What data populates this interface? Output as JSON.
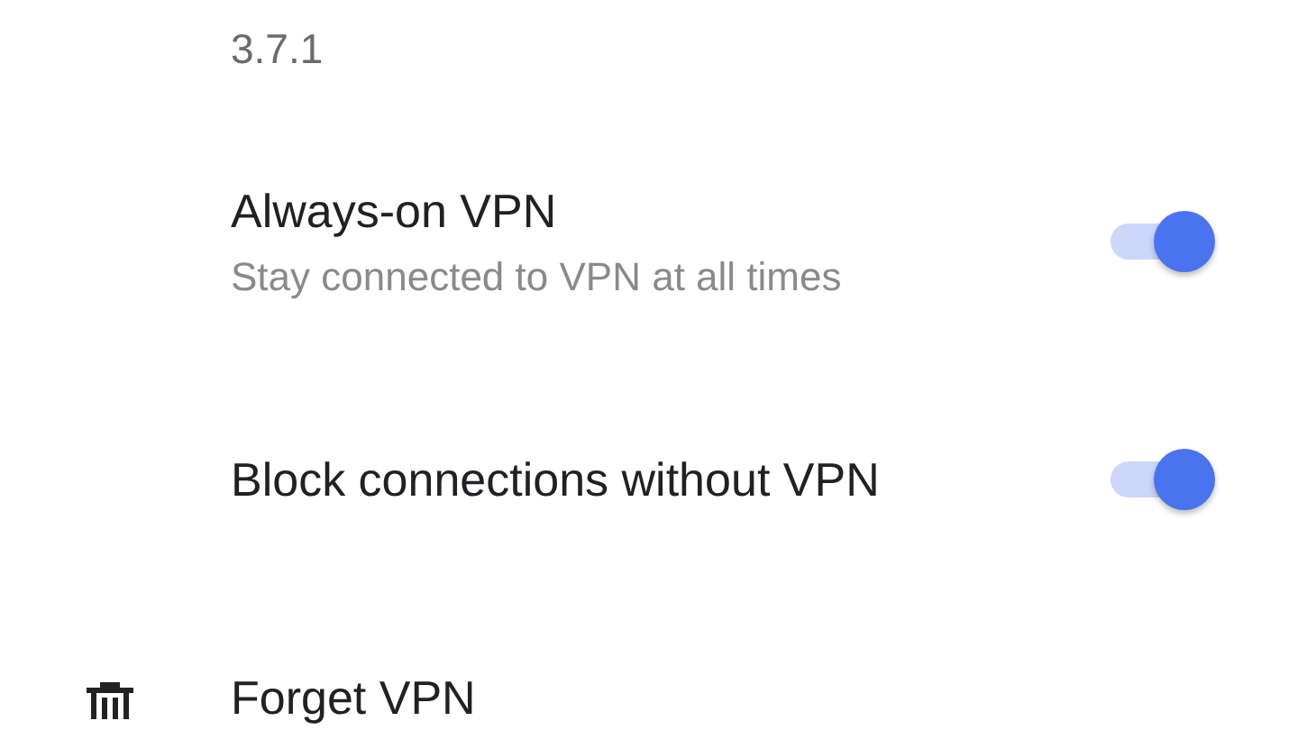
{
  "version": {
    "value": "3.7.1"
  },
  "settings": [
    {
      "title": "Always-on VPN",
      "summary": "Stay connected to VPN at all times",
      "on": true
    },
    {
      "title": "Block connections without VPN",
      "on": true
    }
  ],
  "forget": {
    "label": "Forget VPN"
  }
}
